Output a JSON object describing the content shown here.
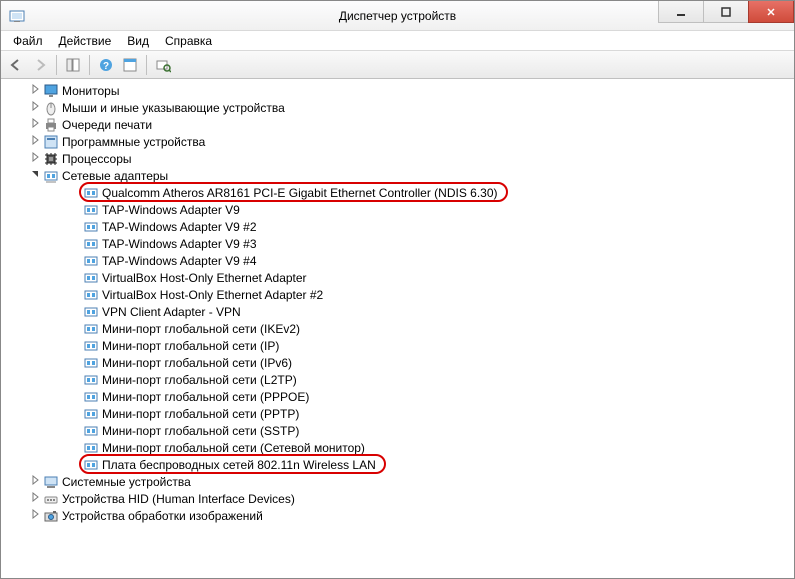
{
  "window": {
    "title": "Диспетчер устройств"
  },
  "menu": {
    "file": "Файл",
    "action": "Действие",
    "view": "Вид",
    "help": "Справка"
  },
  "tree": {
    "categories": [
      {
        "label": "Мониторы",
        "expanded": false,
        "icon": "monitor"
      },
      {
        "label": "Мыши и иные указывающие устройства",
        "expanded": false,
        "icon": "mouse"
      },
      {
        "label": "Очереди печати",
        "expanded": false,
        "icon": "printer"
      },
      {
        "label": "Программные устройства",
        "expanded": false,
        "icon": "software"
      },
      {
        "label": "Процессоры",
        "expanded": false,
        "icon": "cpu"
      },
      {
        "label": "Сетевые адаптеры",
        "expanded": true,
        "icon": "network",
        "children": [
          {
            "label": "Qualcomm Atheros AR8161 PCI-E Gigabit Ethernet Controller (NDIS 6.30)",
            "highlight": true
          },
          {
            "label": "TAP-Windows Adapter V9"
          },
          {
            "label": "TAP-Windows Adapter V9 #2"
          },
          {
            "label": "TAP-Windows Adapter V9 #3"
          },
          {
            "label": "TAP-Windows Adapter V9 #4"
          },
          {
            "label": "VirtualBox Host-Only Ethernet Adapter"
          },
          {
            "label": "VirtualBox Host-Only Ethernet Adapter #2"
          },
          {
            "label": "VPN Client Adapter - VPN"
          },
          {
            "label": "Мини-порт глобальной сети (IKEv2)"
          },
          {
            "label": "Мини-порт глобальной сети (IP)"
          },
          {
            "label": "Мини-порт глобальной сети (IPv6)"
          },
          {
            "label": "Мини-порт глобальной сети (L2TP)"
          },
          {
            "label": "Мини-порт глобальной сети (PPPOE)"
          },
          {
            "label": "Мини-порт глобальной сети (PPTP)"
          },
          {
            "label": "Мини-порт глобальной сети (SSTP)"
          },
          {
            "label": "Мини-порт глобальной сети (Сетевой монитор)"
          },
          {
            "label": "Плата беспроводных сетей 802.11n Wireless LAN",
            "highlight": true
          }
        ]
      },
      {
        "label": "Системные устройства",
        "expanded": false,
        "icon": "system"
      },
      {
        "label": "Устройства HID (Human Interface Devices)",
        "expanded": false,
        "icon": "hid"
      },
      {
        "label": "Устройства обработки изображений",
        "expanded": false,
        "icon": "imaging"
      }
    ]
  }
}
